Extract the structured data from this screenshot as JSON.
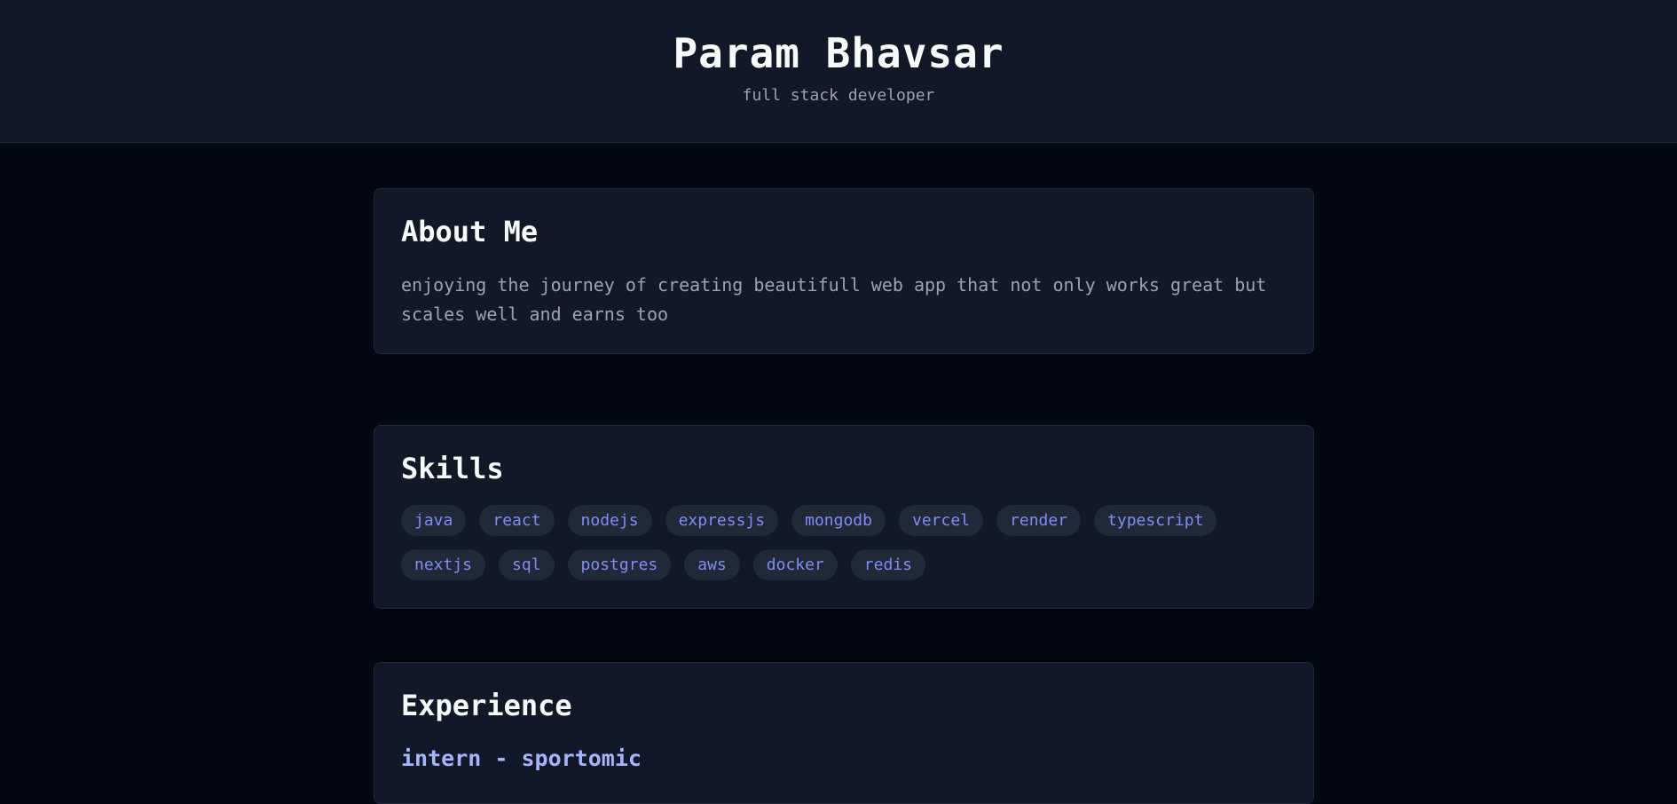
{
  "header": {
    "name": "Param Bhavsar",
    "tagline": "full stack developer"
  },
  "about": {
    "title": "About Me",
    "text": "enjoying the journey of creating beautifull web app that not only works great but scales well and earns too"
  },
  "skills": {
    "title": "Skills",
    "items": [
      "java",
      "react",
      "nodejs",
      "expressjs",
      "mongodb",
      "vercel",
      "render",
      "typescript",
      "nextjs",
      "sql",
      "postgres",
      "aws",
      "docker",
      "redis"
    ]
  },
  "experience": {
    "title": "Experience",
    "role": "intern - sportomic"
  },
  "colors": {
    "page_bg": "#030712",
    "card_bg": "#111827",
    "chip_bg": "#1f2937",
    "chip_text": "#818cf8",
    "role_text": "#a5b4fc"
  }
}
